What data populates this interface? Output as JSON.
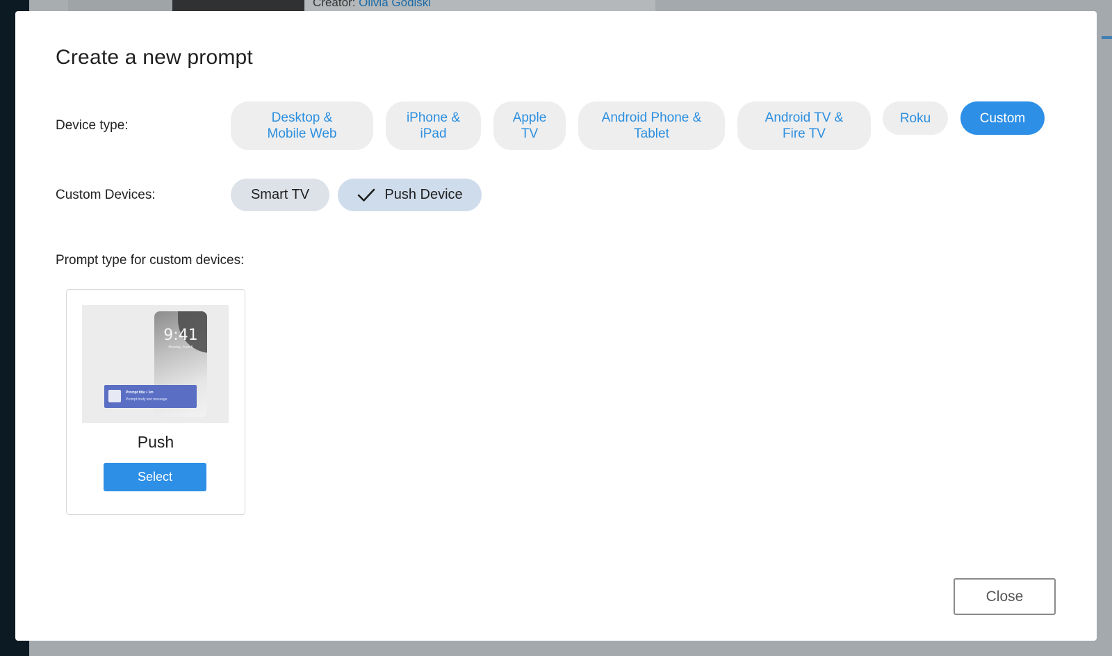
{
  "background": {
    "creator_label": "Creator:",
    "creator_name": "Olivia Godiski"
  },
  "modal": {
    "title": "Create a new prompt",
    "device_type_label": "Device type:",
    "device_types": [
      {
        "label_line1": "Desktop &",
        "label_line2": "Mobile Web",
        "selected": false
      },
      {
        "label_line1": "iPhone &",
        "label_line2": "iPad",
        "selected": false
      },
      {
        "label_line1": "Apple",
        "label_line2": "TV",
        "selected": false
      },
      {
        "label_line1": "Android Phone &",
        "label_line2": "Tablet",
        "selected": false
      },
      {
        "label_line1": "Android TV &",
        "label_line2": "Fire TV",
        "selected": false
      },
      {
        "label_line1": "Roku",
        "label_line2": "",
        "selected": false
      },
      {
        "label_line1": "Custom",
        "label_line2": "",
        "selected": true
      }
    ],
    "custom_devices_label": "Custom Devices:",
    "custom_devices": [
      {
        "label": "Smart TV",
        "checked": false
      },
      {
        "label": "Push Device",
        "checked": true
      }
    ],
    "prompt_type_label": "Prompt type for custom devices:",
    "prompt_card": {
      "name": "Push",
      "select_label": "Select",
      "preview": {
        "time": "9:41",
        "date": "Monday, June 6",
        "notif_title": "Prompt title • 1m",
        "notif_body": "Prompt body text message"
      }
    },
    "close_label": "Close"
  },
  "colors": {
    "accent": "#2d8fe6",
    "pill_bg": "#eeeeee",
    "pill_text": "#2b8fe0",
    "chip_selected_bg": "#cfdceb",
    "notif_bg": "#5a6fc4"
  }
}
